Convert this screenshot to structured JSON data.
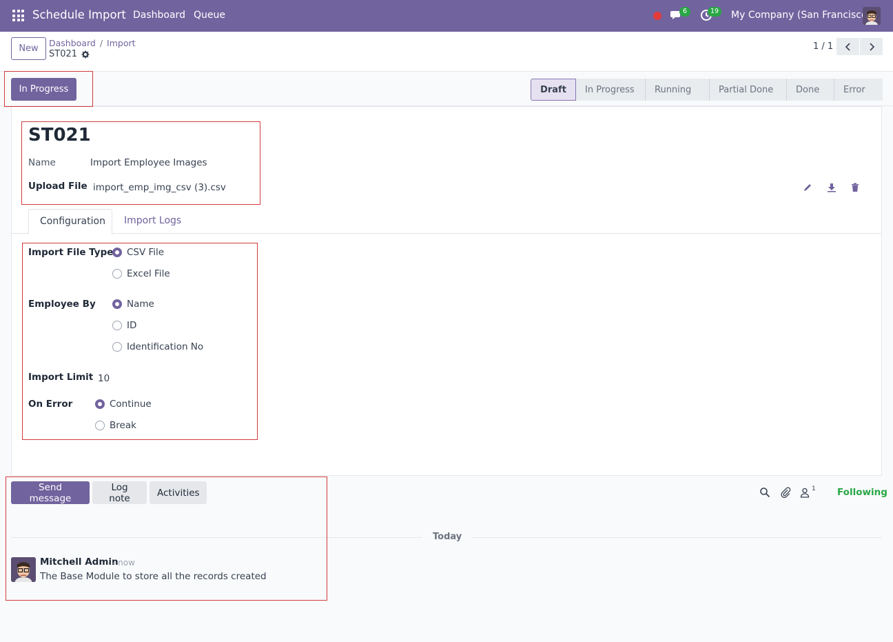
{
  "navbar": {
    "app_title": "Schedule Import",
    "menus": [
      "Dashboard",
      "Queue"
    ],
    "messages_count": "6",
    "activities_count": "19",
    "company": "My Company (San Francisco)",
    "accent": "#71639e"
  },
  "control": {
    "new_label": "New",
    "breadcrumb": [
      "Dashboard",
      "Import"
    ],
    "record": "ST021",
    "pager": "1 / 1"
  },
  "status": {
    "action_label": "In Progress",
    "stages": [
      "Draft",
      "In Progress",
      "Running",
      "Partial Done",
      "Done",
      "Error"
    ],
    "active_stage": "Draft"
  },
  "form": {
    "title": "ST021",
    "name_label": "Name",
    "name_value": "Import Employee Images",
    "upload_label": "Upload File",
    "upload_value": "import_emp_img_csv (3).csv",
    "tabs": [
      "Configuration",
      "Import Logs"
    ],
    "file_type_label": "Import File Type",
    "file_type_options": [
      "CSV File",
      "Excel File"
    ],
    "employee_by_label": "Employee By",
    "employee_by_options": [
      "Name",
      "ID",
      "Identification No"
    ],
    "limit_label": "Import Limit",
    "limit_value": "10",
    "on_error_label": "On Error",
    "on_error_options": [
      "Continue",
      "Break"
    ]
  },
  "chatter": {
    "send_label": "Send message",
    "log_label": "Log note",
    "activities_label": "Activities",
    "followers_count": "1",
    "following_label": "Following",
    "today_label": "Today",
    "author": "Mitchell Admin",
    "time": "- now",
    "body": "The Base Module to store all the records created"
  }
}
